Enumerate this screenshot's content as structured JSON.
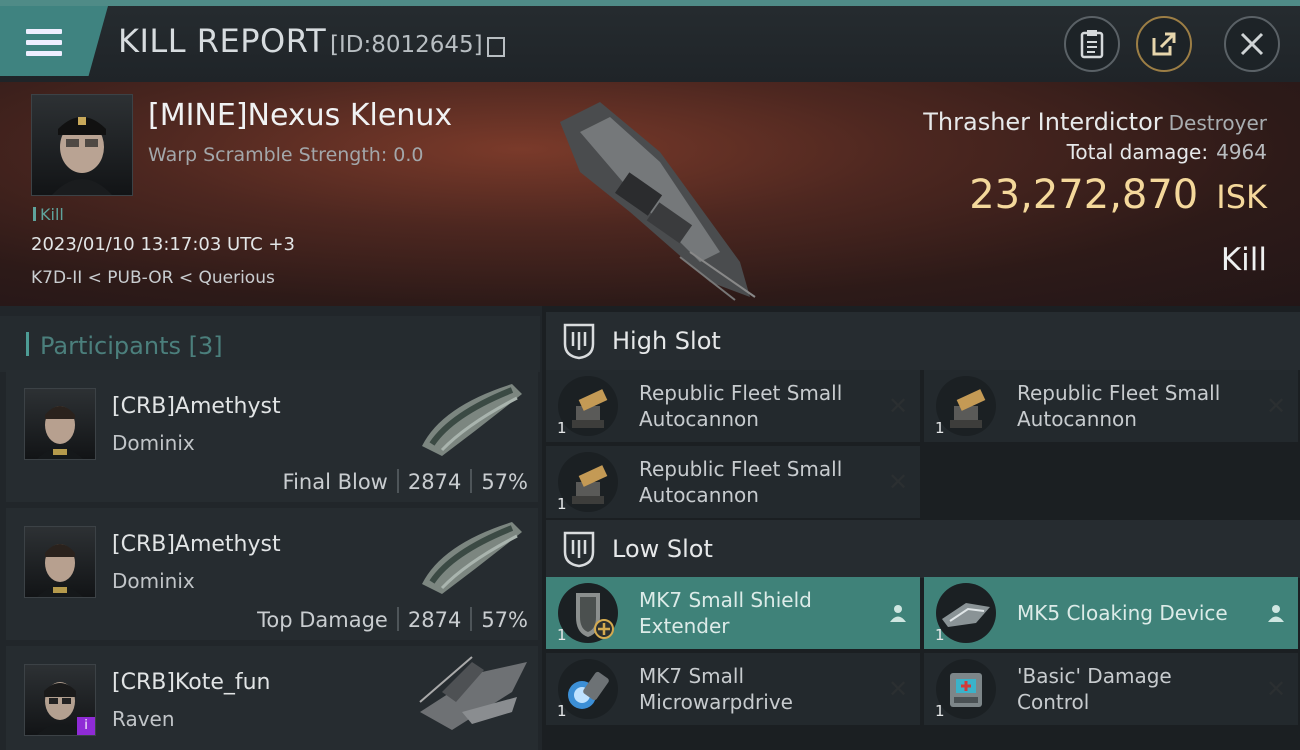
{
  "header": {
    "title": "KILL REPORT",
    "kill_id": "[ID:8012645]"
  },
  "victim": {
    "name": "[MINE]Nexus Klenux",
    "warp_scramble": "Warp Scramble Strength: 0.0",
    "tag": "Kill",
    "datetime": "2023/01/10 13:17:03 UTC +3",
    "location": "K7D-II < PUB-OR < Querious",
    "ship_name": "Thrasher Interdictor",
    "ship_class": "Destroyer",
    "total_damage_label": "Total damage:",
    "total_damage": "4964",
    "isk_value": "23,272,870",
    "isk_unit": "ISK",
    "result": "Kill"
  },
  "participants": {
    "title": "Participants",
    "count": "[3]",
    "items": [
      {
        "name": "[CRB]Amethyst",
        "ship": "Dominix",
        "role": "Final Blow",
        "damage": "2874",
        "percent": "57%"
      },
      {
        "name": "[CRB]Amethyst",
        "ship": "Dominix",
        "role": "Top Damage",
        "damage": "2874",
        "percent": "57%"
      },
      {
        "name": "[CRB]Kote_fun",
        "ship": "Raven",
        "role": "",
        "damage": "",
        "percent": "",
        "badge": "i"
      }
    ]
  },
  "high_slot": {
    "title": "High Slot",
    "modules": [
      {
        "name": "Republic Fleet Small Autocannon",
        "qty": "1",
        "state": "destroyed",
        "icon": "autocannon-icon"
      },
      {
        "name": "Republic Fleet Small Autocannon",
        "qty": "1",
        "state": "destroyed",
        "icon": "autocannon-icon"
      },
      {
        "name": "Republic Fleet Small Autocannon",
        "qty": "1",
        "state": "destroyed",
        "icon": "autocannon-icon"
      }
    ]
  },
  "low_slot": {
    "title": "Low Slot",
    "modules": [
      {
        "name": "MK7 Small Shield Extender",
        "qty": "1",
        "state": "dropped",
        "icon": "shield-extender-icon"
      },
      {
        "name": "MK5 Cloaking Device",
        "qty": "1",
        "state": "dropped",
        "icon": "cloaking-device-icon"
      },
      {
        "name": "MK7 Small Microwarpdrive",
        "qty": "1",
        "state": "destroyed",
        "icon": "microwarpdrive-icon"
      },
      {
        "name": "'Basic' Damage Control",
        "qty": "1",
        "state": "destroyed",
        "icon": "damage-control-icon"
      }
    ]
  },
  "colors": {
    "accent": "#3f8380",
    "isk": "#f4d89b",
    "fitted_row": "#3f8279"
  }
}
